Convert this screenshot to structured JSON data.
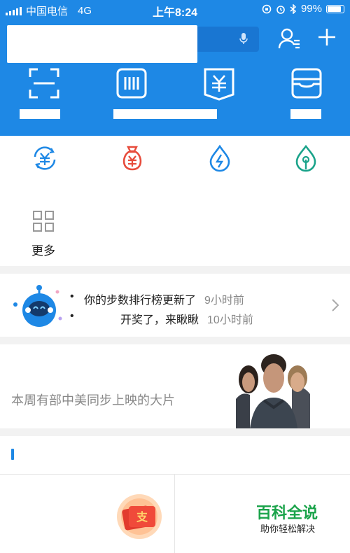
{
  "status_bar": {
    "carrier": "中国电信",
    "network": "4G",
    "time": "上午8:24",
    "battery": "99%"
  },
  "header": {
    "icons": [
      "contacts-icon",
      "add-icon",
      "scan-icon",
      "pay-icon",
      "collect-icon",
      "card-pack-icon"
    ]
  },
  "grid": {
    "more_label": "更多"
  },
  "messages": {
    "items": [
      {
        "text": "你的步数排行榜更新了",
        "time": "9小时前"
      },
      {
        "text": "开奖了，来瞅瞅",
        "time": "10小时前"
      }
    ]
  },
  "movie": {
    "text": "本周有部中美同步上映的大片"
  },
  "watermark": {
    "title": "百科全说",
    "subtitle": "助你轻松解决"
  },
  "colors": {
    "brand_blue": "#1e88e5",
    "red": "#e74c3c",
    "teal": "#1aa38a"
  }
}
